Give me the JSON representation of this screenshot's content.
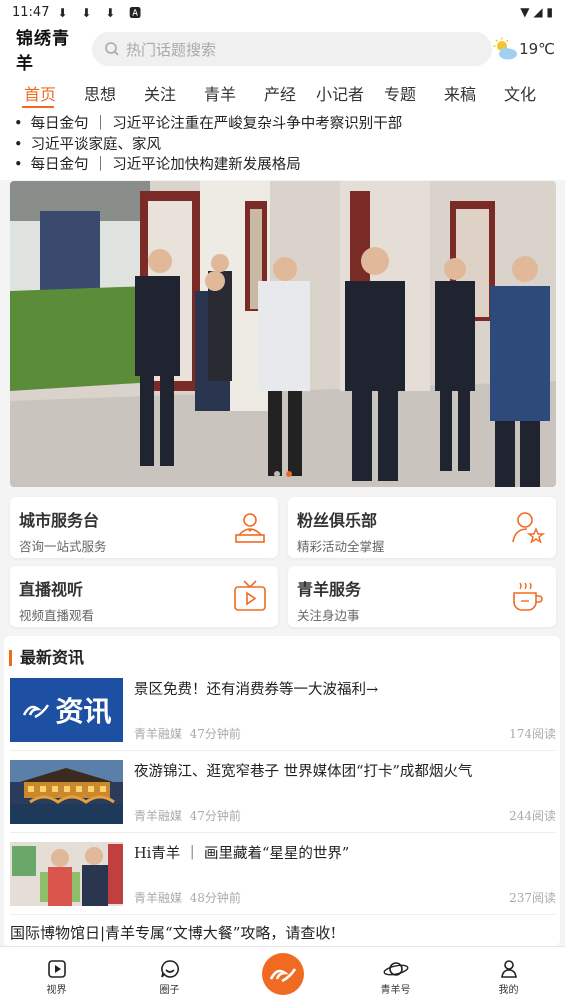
{
  "status": {
    "time": "11:47",
    "download_glyphs": "⬇ ⬇ ⬇ 🅰",
    "right_glyphs": "▼ ◢ ▮"
  },
  "header": {
    "logo": "锦绣青羊",
    "search_placeholder": "热门话题搜索",
    "weather": "19℃",
    "weather_icon": "sun-cloud-icon"
  },
  "tabs": [
    "首页",
    "思想",
    "关注",
    "青羊",
    "产经",
    "小记者",
    "专题",
    "来稿",
    "文化"
  ],
  "active_tab": 0,
  "ticker": [
    "每日金句 ｜ 习近平论注重在严峻复杂斗争中考察识别干部",
    "习近平谈家庭、家风",
    "每日金句 ｜ 习近平论加快构建新发展格局"
  ],
  "carousel": {
    "slides": 2,
    "active": 1
  },
  "services": [
    {
      "title": "城市服务台",
      "subtitle": "咨询一站式服务",
      "icon": "service-desk-icon"
    },
    {
      "title": "粉丝俱乐部",
      "subtitle": "精彩活动全掌握",
      "icon": "fan-star-icon"
    },
    {
      "title": "直播视听",
      "subtitle": "视频直播观看",
      "icon": "tv-play-icon"
    },
    {
      "title": "青羊服务",
      "subtitle": "关注身边事",
      "icon": "coffee-cup-icon"
    }
  ],
  "news": {
    "title": "最新资讯",
    "items": [
      {
        "headline": "景区免费！还有消费券等一大波福利→",
        "source": "青羊融媒",
        "time": "47分钟前",
        "reads": "174阅读",
        "thumb_text": "资讯"
      },
      {
        "headline": "夜游锦江、逛宽窄巷子 世界媒体团“打卡”成都烟火气",
        "source": "青羊融媒",
        "time": "47分钟前",
        "reads": "244阅读"
      },
      {
        "headline": "Hi青羊 ｜ 画里藏着“星星的世界”",
        "source": "青羊融媒",
        "time": "48分钟前",
        "reads": "237阅读"
      }
    ],
    "partial_headline": "国际博物馆日|青羊专属“文博大餐”攻略，请查收!"
  },
  "bottom_nav": [
    {
      "label": "视界",
      "icon": "video-play-icon"
    },
    {
      "label": "圈子",
      "icon": "chat-smile-icon"
    },
    {
      "label": "",
      "icon": "center-logo-icon"
    },
    {
      "label": "青羊号",
      "icon": "planet-icon"
    },
    {
      "label": "我的",
      "icon": "user-icon"
    }
  ],
  "colors": {
    "accent": "#f06b21"
  }
}
